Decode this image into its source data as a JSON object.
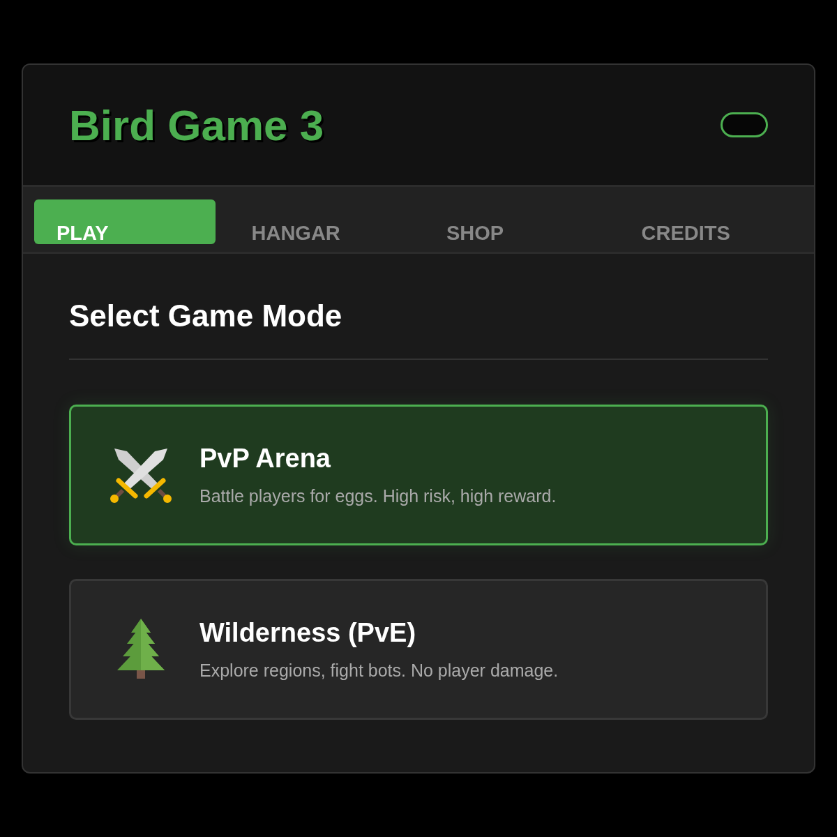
{
  "header": {
    "title": "Bird Game 3"
  },
  "tabs": [
    {
      "label": "PLAY",
      "selected": true
    },
    {
      "label": "HANGAR",
      "selected": false
    },
    {
      "label": "SHOP",
      "selected": false
    },
    {
      "label": "CREDITS",
      "selected": false
    }
  ],
  "section_title": "Select Game Mode",
  "modes": [
    {
      "kind": "swords",
      "title": "PvP Arena",
      "description": "Battle players for eggs. High risk, high reward.",
      "selected": true
    },
    {
      "kind": "tree",
      "title": "Wilderness (PvE)",
      "description": "Explore regions, fight bots. No player damage.",
      "selected": false
    }
  ]
}
